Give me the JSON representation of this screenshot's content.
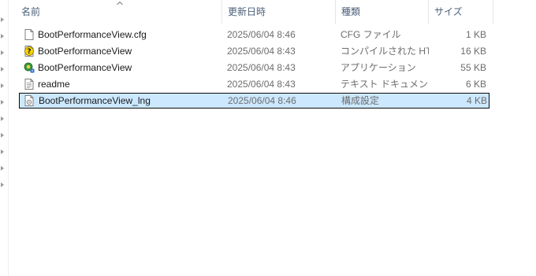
{
  "columns": {
    "name": "名前",
    "date": "更新日時",
    "type": "種類",
    "size": "サイズ"
  },
  "files": [
    {
      "name": "BootPerformanceView.cfg",
      "date": "2025/06/04 8:46",
      "type": "CFG ファイル",
      "size": "1 KB",
      "icon": "cfg-file-icon",
      "selected": false
    },
    {
      "name": "BootPerformanceView",
      "date": "2025/06/04 8:43",
      "type": "コンパイルされた HT...",
      "size": "16 KB",
      "icon": "chm-help-icon",
      "selected": false
    },
    {
      "name": "BootPerformanceView",
      "date": "2025/06/04 8:43",
      "type": "アプリケーション",
      "size": "55 KB",
      "icon": "application-icon",
      "selected": false
    },
    {
      "name": "readme",
      "date": "2025/06/04 8:43",
      "type": "テキスト ドキュメント",
      "size": "6 KB",
      "icon": "text-document-icon",
      "selected": false
    },
    {
      "name": "BootPerformanceView_lng",
      "date": "2025/06/04 8:46",
      "type": "構成設定",
      "size": "4 KB",
      "icon": "config-settings-icon",
      "selected": true
    }
  ],
  "colors": {
    "selection_fill": "#cce8ff",
    "header_text": "#4c607a",
    "meta_text": "#6d6d6d"
  }
}
